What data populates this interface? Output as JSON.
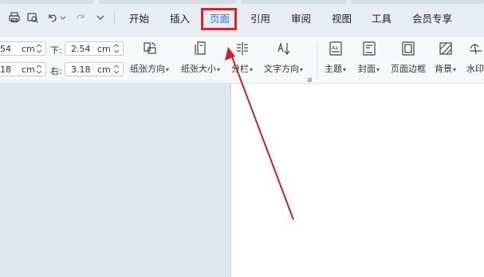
{
  "quick_access": {
    "icons": [
      "print-icon",
      "print-preview-icon",
      "undo-icon",
      "redo-icon",
      "customize-dropdown-icon"
    ]
  },
  "tabs": [
    {
      "label": "开始"
    },
    {
      "label": "插入"
    },
    {
      "label": "页面",
      "active": true
    },
    {
      "label": "引用"
    },
    {
      "label": "审阅"
    },
    {
      "label": "视图"
    },
    {
      "label": "工具"
    },
    {
      "label": "会员专享"
    }
  ],
  "margins": {
    "top_value": "54",
    "top_unit": "cm",
    "left_value": "18",
    "left_unit": "cm",
    "bottom_label": "下:",
    "bottom_value": "2.54",
    "bottom_unit": "cm",
    "right_label": "右:",
    "right_value": "3.18",
    "right_unit": "cm"
  },
  "ribbon_buttons": [
    {
      "label": "纸张方向",
      "icon": "paper-orientation-icon"
    },
    {
      "label": "纸张大小",
      "icon": "paper-size-icon"
    },
    {
      "label": "分栏",
      "icon": "columns-icon"
    },
    {
      "label": "文字方向",
      "icon": "text-direction-icon"
    },
    {
      "label": "主题",
      "icon": "theme-icon"
    },
    {
      "label": "封面",
      "icon": "cover-icon"
    },
    {
      "label": "页面边框",
      "icon": "page-border-icon"
    },
    {
      "label": "背景",
      "icon": "background-icon"
    },
    {
      "label": "水印",
      "icon": "watermark-icon"
    }
  ],
  "colors": {
    "accent": "#3a6fd8",
    "highlight": "#e3212a",
    "annotation_arrow": "#c8232b"
  }
}
